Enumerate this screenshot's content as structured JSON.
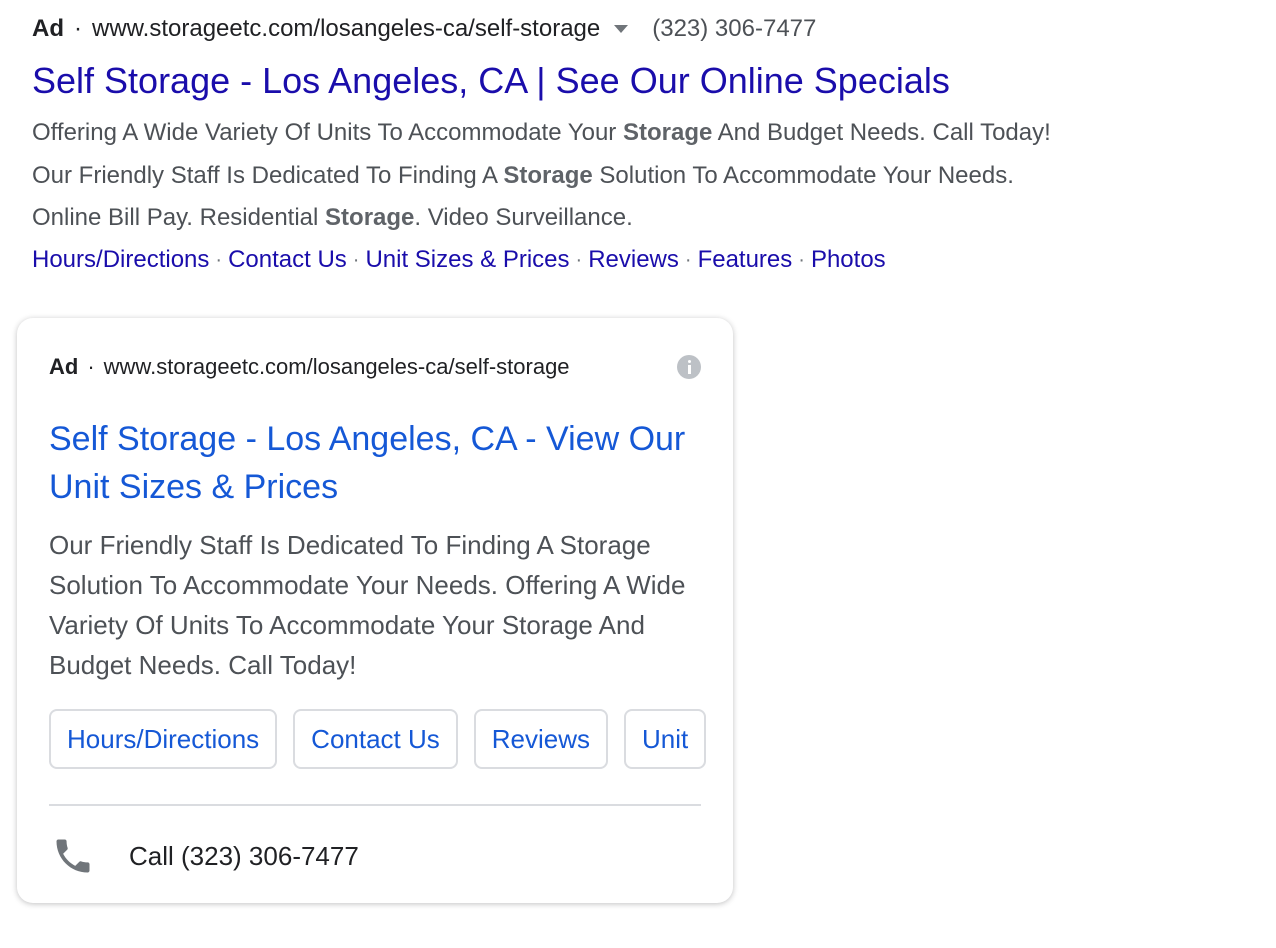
{
  "desktop_ad": {
    "badge": "Ad",
    "separator": "·",
    "url": "www.storageetc.com/losangeles-ca/self-storage",
    "phone": "(323) 306-7477",
    "headline": "Self Storage - Los Angeles, CA | See Our Online Specials",
    "description": {
      "line1_a": "Offering A Wide Variety Of Units To Accommodate Your ",
      "line1_bold": "Storage",
      "line1_b": " And Budget Needs. Call Today!",
      "line2_a": "Our Friendly Staff Is Dedicated To Finding A ",
      "line2_bold": "Storage",
      "line2_b": " Solution To Accommodate Your Needs.",
      "line3_a": "Online Bill Pay. Residential ",
      "line3_bold": "Storage",
      "line3_b": ". Video Surveillance."
    },
    "sitelinks": [
      {
        "label": "Hours/Directions"
      },
      {
        "label": "Contact Us"
      },
      {
        "label": "Unit Sizes & Prices"
      },
      {
        "label": "Reviews"
      },
      {
        "label": "Features"
      },
      {
        "label": "Photos"
      }
    ],
    "sitelink_separator": "·"
  },
  "mobile_ad": {
    "badge": "Ad",
    "separator": "·",
    "url": "www.storageetc.com/losangeles-ca/self-storage",
    "info_icon": "info-icon",
    "headline": "Self Storage - Los Angeles, CA - View Our Unit Sizes & Prices",
    "description": "Our Friendly Staff Is Dedicated To Finding A Storage Solution To Accommodate Your Needs. Offering A Wide Variety Of Units To Accommodate Your Storage And Budget Needs. Call Today!",
    "chips": [
      {
        "label": "Hours/Directions"
      },
      {
        "label": "Contact Us"
      },
      {
        "label": "Reviews"
      },
      {
        "label": "Unit"
      }
    ],
    "call_icon": "phone-icon",
    "call_label": "Call (323) 306-7477"
  },
  "colors": {
    "link_desktop": "#1a0dab",
    "link_mobile": "#1558d6",
    "text_primary": "#202124",
    "text_secondary": "#4d5156",
    "border": "#dadce0"
  }
}
